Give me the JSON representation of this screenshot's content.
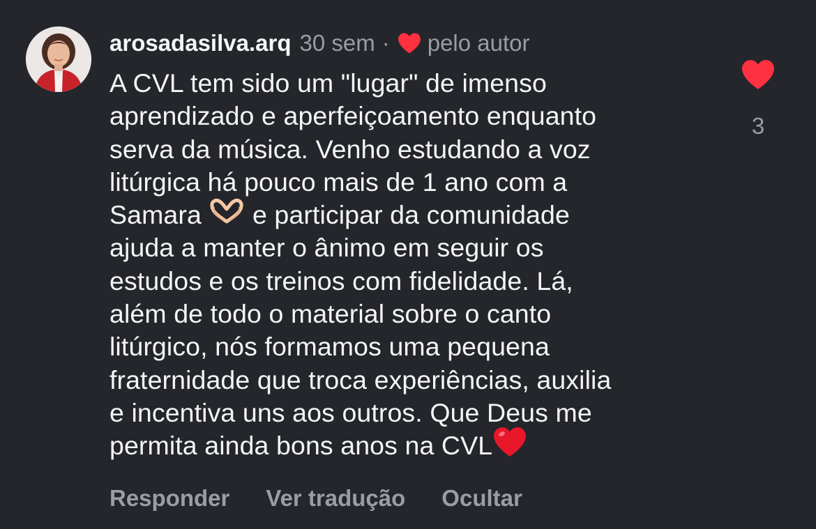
{
  "comment": {
    "username": "arosadasilva.arq",
    "time": "30 sem",
    "separator": "·",
    "liked_by_author_label": "pelo autor",
    "text_part1": "A CVL tem sido um \"lugar\" de imenso\naprendizado e aperfeiçoamento enquanto\nserva da música. Venho estudando a voz\nlitúrgica há pouco mais de 1 ano com a\nSamara ",
    "text_part2": " e participar da comunidade\najuda a manter o ânimo em seguir os\nestudos e os treinos com fidelidade. Lá,\nalém de todo o material sobre o canto\nlitúrgico, nós formamos uma pequena\nfraternidade que troca experiências, auxilia\ne incentiva uns aos outros. Que Deus me\npermita ainda bons anos  na CVL",
    "emoji_1": "heart-hands-emoji",
    "emoji_2": "red-heart-emoji",
    "like_count": "3"
  },
  "actions": {
    "reply_label": "Responder",
    "translate_label": "Ver tradução",
    "hide_label": "Ocultar"
  },
  "colors": {
    "background": "#24262b",
    "text": "#f4f5f6",
    "muted": "#9a9da3",
    "heart": "#ff3040"
  },
  "icons": {
    "author_like": "heart-icon",
    "like_button": "heart-icon"
  }
}
